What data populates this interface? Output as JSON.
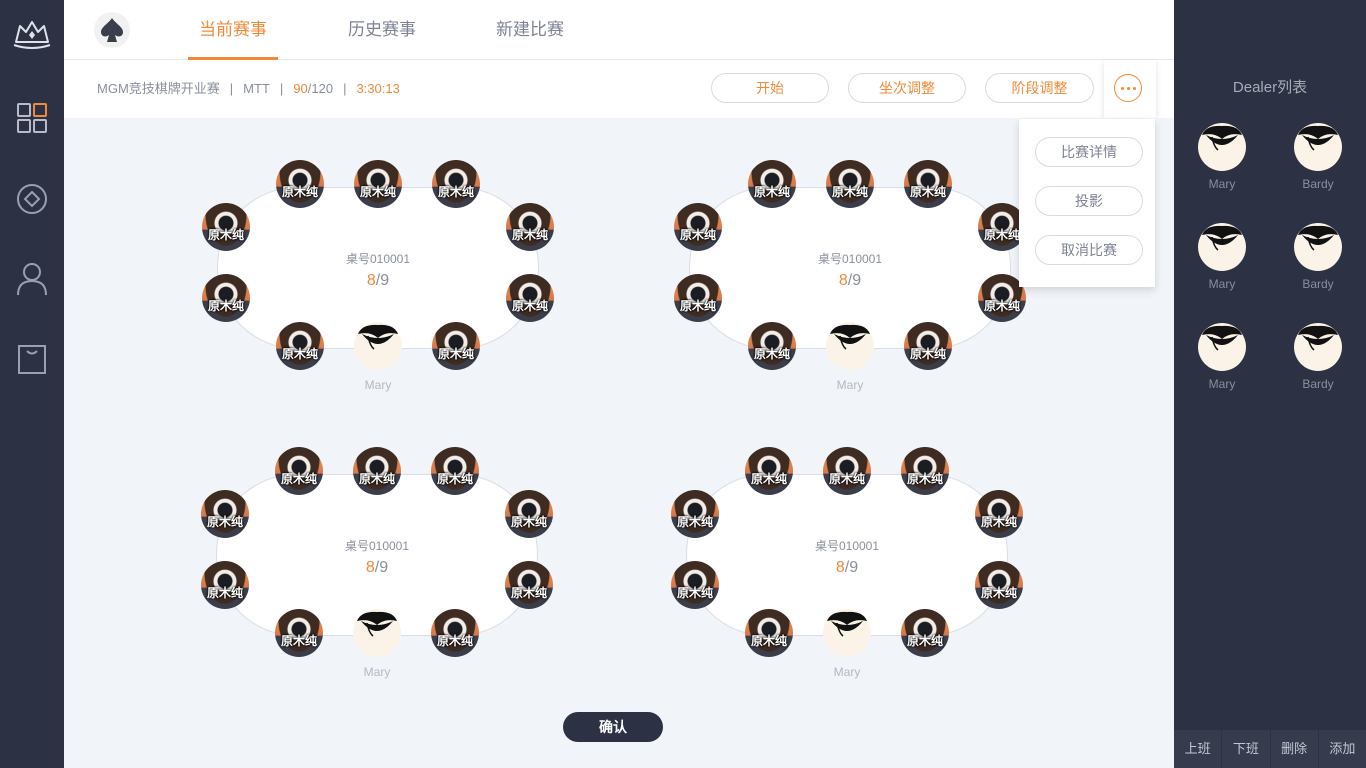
{
  "header": {
    "tabs": [
      {
        "label": "当前赛事",
        "active": true
      },
      {
        "label": "历史赛事",
        "active": false
      },
      {
        "label": "新建比赛",
        "active": false
      }
    ]
  },
  "nav": {
    "items": [
      "dashboard-icon",
      "diamond-icon",
      "user-icon",
      "bag-icon"
    ]
  },
  "match": {
    "name": "MGM竞技棋牌开业赛",
    "type": "MTT",
    "players_current": "90",
    "players_total": "/120",
    "timer": "3:30:13",
    "sep": "|"
  },
  "actions": {
    "start": "开始",
    "seat_adjust": "坐次调整",
    "stage_adjust": "阶段调整"
  },
  "dropdown": {
    "items": [
      "比赛详情",
      "投影",
      "取消比赛"
    ]
  },
  "tables": [
    {
      "label": "桌号010001",
      "filled": "8",
      "total": "/9",
      "player_name": "原木纯",
      "dealer": "Mary"
    },
    {
      "label": "桌号010001",
      "filled": "8",
      "total": "/9",
      "player_name": "原木纯",
      "dealer": "Mary"
    },
    {
      "label": "桌号010001",
      "filled": "8",
      "total": "/9",
      "player_name": "原木纯",
      "dealer": "Mary"
    },
    {
      "label": "桌号010001",
      "filled": "8",
      "total": "/9",
      "player_name": "原木纯",
      "dealer": "Mary"
    }
  ],
  "confirm": "确认",
  "dealer_panel": {
    "title": "Dealer列表",
    "dealers": [
      "Mary",
      "Bardy",
      "Mary",
      "Bardy",
      "Mary",
      "Bardy"
    ],
    "buttons": [
      "上班",
      "下班",
      "删除",
      "添加"
    ]
  },
  "colors": {
    "accent": "#f08a3a",
    "sidebar": "#2c3144"
  }
}
